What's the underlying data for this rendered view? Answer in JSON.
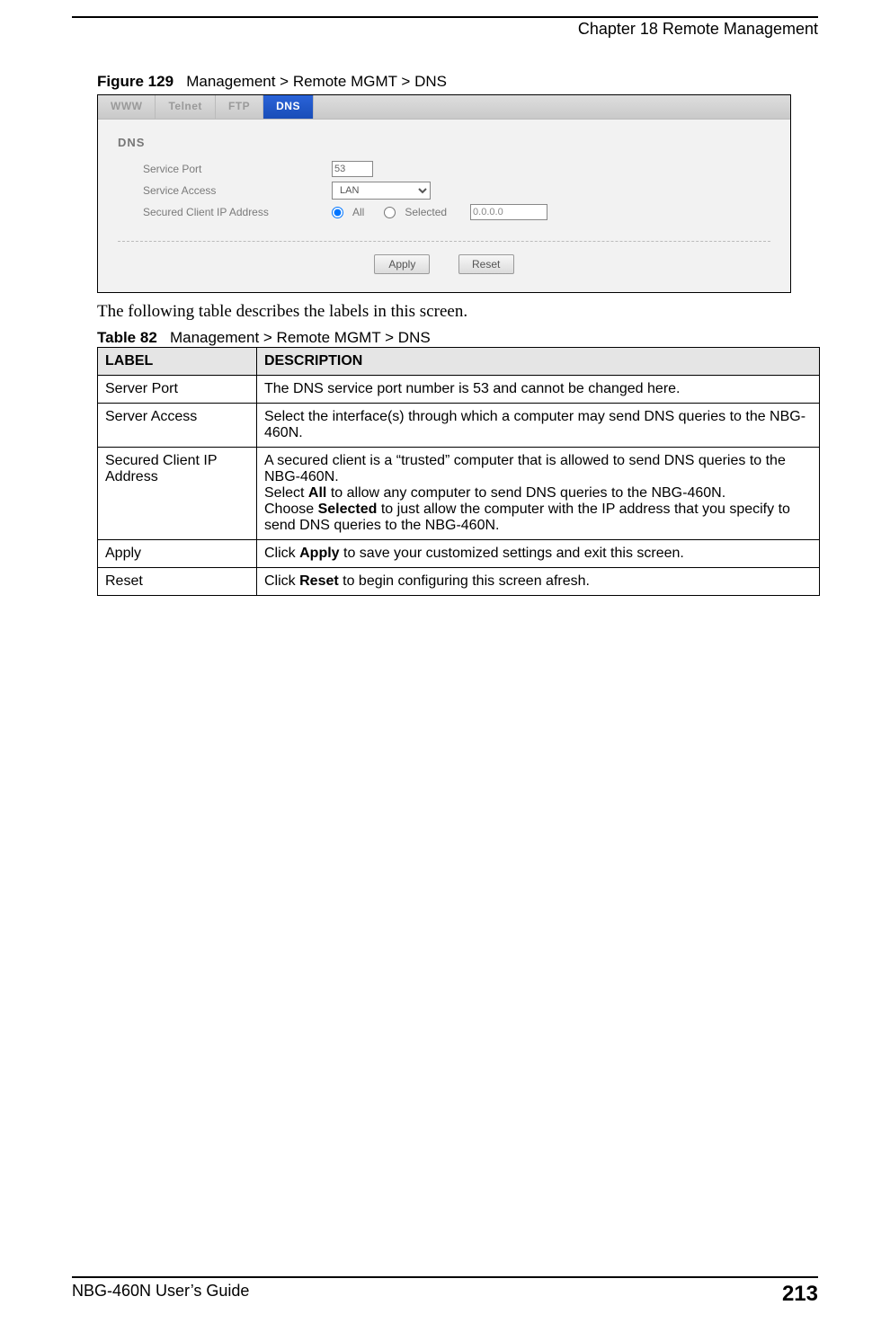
{
  "header": {
    "chapter": "Chapter 18 Remote Management"
  },
  "figure": {
    "label": "Figure 129",
    "caption": "Management > Remote MGMT > DNS"
  },
  "screenshot": {
    "tabs": {
      "www": "WWW",
      "telnet": "Telnet",
      "ftp": "FTP",
      "dns": "DNS"
    },
    "section_title": "DNS",
    "labels": {
      "service_port": "Service Port",
      "service_access": "Service Access",
      "secured_client": "Secured Client IP Address"
    },
    "service_port_value": "53",
    "service_access_value": "LAN",
    "radio_all": "All",
    "radio_selected": "Selected",
    "ip_value": "0.0.0.0",
    "apply_btn": "Apply",
    "reset_btn": "Reset"
  },
  "intro_text": "The following table describes the labels in this screen.",
  "table": {
    "label": "Table 82",
    "caption": "Management > Remote MGMT > DNS",
    "header": {
      "label": "LABEL",
      "description": "DESCRIPTION"
    },
    "rows": [
      {
        "label": "Server Port",
        "desc": "The DNS service port number is 53 and cannot be changed here."
      },
      {
        "label": "Server Access",
        "desc": "Select the interface(s) through which a computer may send DNS queries to the NBG-460N."
      },
      {
        "label": "Secured Client IP Address",
        "desc_p1": "A secured client is a “trusted” computer that is allowed to send DNS queries to the NBG-460N.",
        "desc_p2a": "Select ",
        "desc_p2b": "All",
        "desc_p2c": " to allow any computer to send DNS queries to the NBG-460N.",
        "desc_p3a": "Choose ",
        "desc_p3b": "Selected",
        "desc_p3c": " to just allow the computer with the IP address that you specify to send DNS queries to the NBG-460N."
      },
      {
        "label": "Apply",
        "desc_a": "Click ",
        "desc_b": "Apply",
        "desc_c": " to save your customized settings and exit this screen."
      },
      {
        "label": "Reset",
        "desc_a": "Click ",
        "desc_b": "Reset",
        "desc_c": " to begin configuring this screen afresh."
      }
    ]
  },
  "footer": {
    "guide": "NBG-460N User’s Guide",
    "page": "213"
  }
}
